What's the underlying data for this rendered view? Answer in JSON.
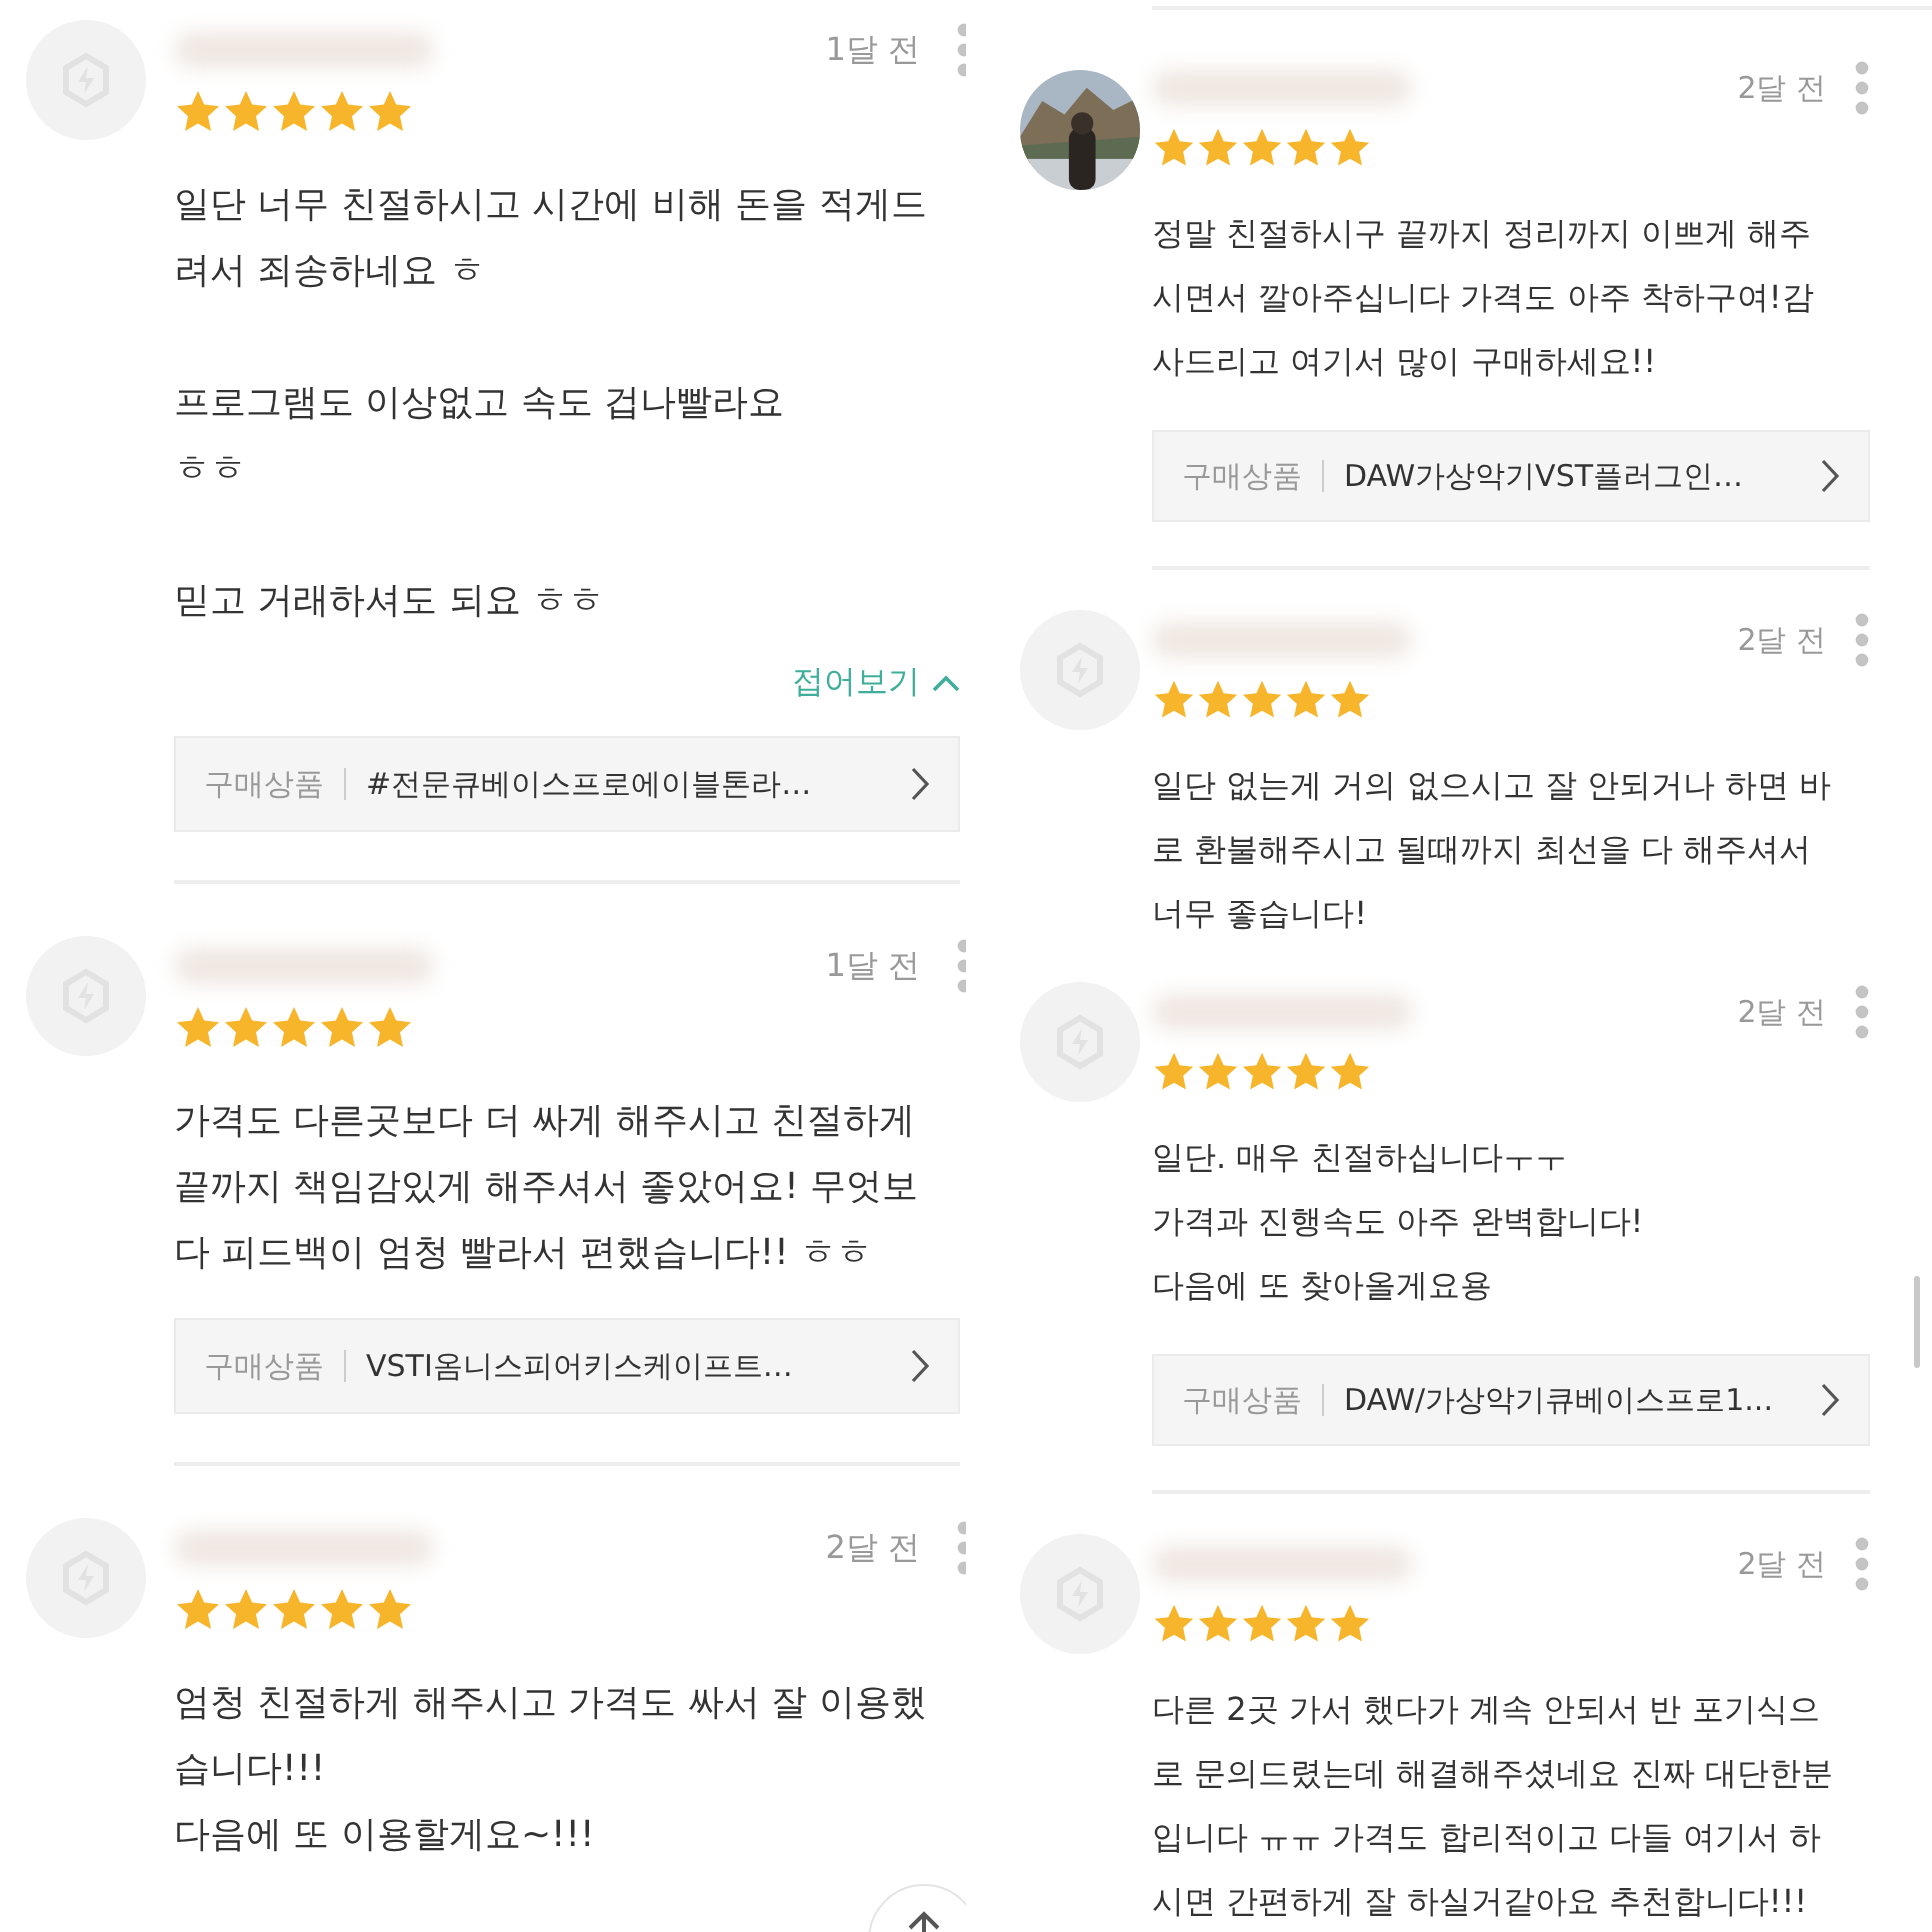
{
  "columns": [
    {
      "top_divider": false,
      "scroll_top": true,
      "reviews": [
        {
          "avatar": {
            "kind": "default"
          },
          "date": "1달 전",
          "stars": 5,
          "body": "일단 너무 친절하시고 시간에 비해 돈을 적게드\n려서 죄송하네요 ㅎ\n\n프로그램도 이상없고 속도 겁나빨라요\nㅎㅎ\n\n믿고 거래하셔도 되요 ㅎㅎ",
          "fold": "접어보기",
          "product": {
            "label": "구매상품",
            "name": "#전문큐베이스프로에이블톤라…"
          },
          "divider_after": true
        },
        {
          "avatar": {
            "kind": "default"
          },
          "date": "1달 전",
          "stars": 5,
          "body": "가격도 다른곳보다 더 싸게 해주시고 친절하게\n끝까지 책임감있게 해주셔서 좋았어요! 무엇보\n다 피드백이 엄청 빨라서 편했습니다!! ㅎㅎ",
          "product": {
            "label": "구매상품",
            "name": "VSTI옴니스피어키스케이프트…"
          },
          "divider_after": true
        },
        {
          "avatar": {
            "kind": "default"
          },
          "date": "2달 전",
          "stars": 5,
          "body": "엄청 친절하게 해주시고 가격도 싸서 잘 이용했\n습니다!!!\n다음에 또 이용할게요~!!!",
          "divider_after": false
        }
      ]
    },
    {
      "top_divider": true,
      "scroll_top": false,
      "reviews": [
        {
          "date": "2달 전",
          "stars": 5,
          "body": "정말 친절하시구 끝까지 정리까지 이쁘게 해주\n시면서 깔아주십니다 가격도 아주 착하구여!감\n사드리고 여기서 많이 구매하세요!!",
          "product": {
            "label": "구매상품",
            "name": "DAW가상악기VST플러그인…"
          },
          "divider_after": true
        },
        {
          "avatar": {
            "kind": "default"
          },
          "date": "2달 전",
          "stars": 5,
          "body": "일단 없는게 거의 없으시고 잘 안되거나 하면 바\n로 환불해주시고 될때까지 최선을 다 해주셔서\n너무 좋습니다!",
          "divider_after": false
        },
        {
          "avatar": {
            "kind": "default"
          },
          "date": "2달 전",
          "stars": 5,
          "body": "일단. 매우 친절하십니다ㅜㅜ\n가격과 진행속도 아주 완벽합니다!\n다음에 또 찾아올게요용",
          "product": {
            "label": "구매상품",
            "name": "DAW/가상악기큐베이스프로1..."
          },
          "divider_after": true
        },
        {
          "avatar": {
            "kind": "default"
          },
          "date": "2달 전",
          "stars": 5,
          "body": "다른 2곳 가서 했다가 계속 안되서 반 포기식으\n로 문의드렸는데 해결해주셨네요 진짜 대단한분\n입니다 ㅠㅠ 가격도 합리적이고 다들 여기서 하\n시면 간편하게 잘 하실거같아요 추천합니다!!!",
          "divider_after": false
        }
      ]
    }
  ]
}
